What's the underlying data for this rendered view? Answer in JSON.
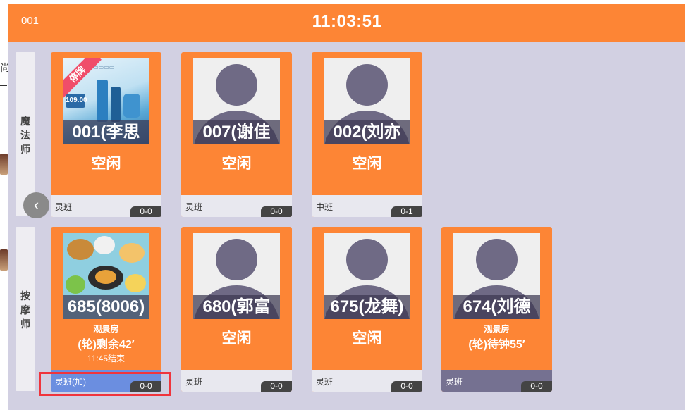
{
  "header": {
    "code": "001",
    "clock": "11:03:51"
  },
  "left_fragments": {
    "char": "尚"
  },
  "nav": {
    "prev_glyph": "‹"
  },
  "rows": [
    {
      "label_chars": [
        "魔",
        "法",
        "师"
      ],
      "cards": [
        {
          "name": "001(李思",
          "state": "空闲",
          "shift": "灵班",
          "count": "0-0",
          "ribbon": "停牌",
          "ad_price": "109.00"
        },
        {
          "name": "007(谢佳",
          "state": "空闲",
          "shift": "灵班",
          "count": "0-0"
        },
        {
          "name": "002(刘亦",
          "state": "空闲",
          "shift": "中班",
          "count": "0-1"
        }
      ]
    },
    {
      "label_chars": [
        "按",
        "摩",
        "师"
      ],
      "cards": [
        {
          "name": "685(8006)",
          "room": "观景房",
          "status": "(轮)剩余42′",
          "end_time": "11:45结束",
          "shift": "灵班(加)",
          "count": "0-0"
        },
        {
          "name": "680(郭富",
          "state": "空闲",
          "shift": "灵班",
          "count": "0-0"
        },
        {
          "name": "675(龙舞)",
          "state": "空闲",
          "shift": "灵班",
          "count": "0-0"
        },
        {
          "name": "674(刘德",
          "room": "观景房",
          "status": "(轮)待钟55′",
          "shift": "灵班",
          "count": "0-0"
        }
      ]
    }
  ],
  "colors": {
    "accent": "#fd8535",
    "background": "#d2d0e2",
    "avatar": "#6f6a85",
    "busy_footer": "#6b8ee0",
    "waiting_footer": "#757191",
    "highlight": "#f0343c"
  }
}
